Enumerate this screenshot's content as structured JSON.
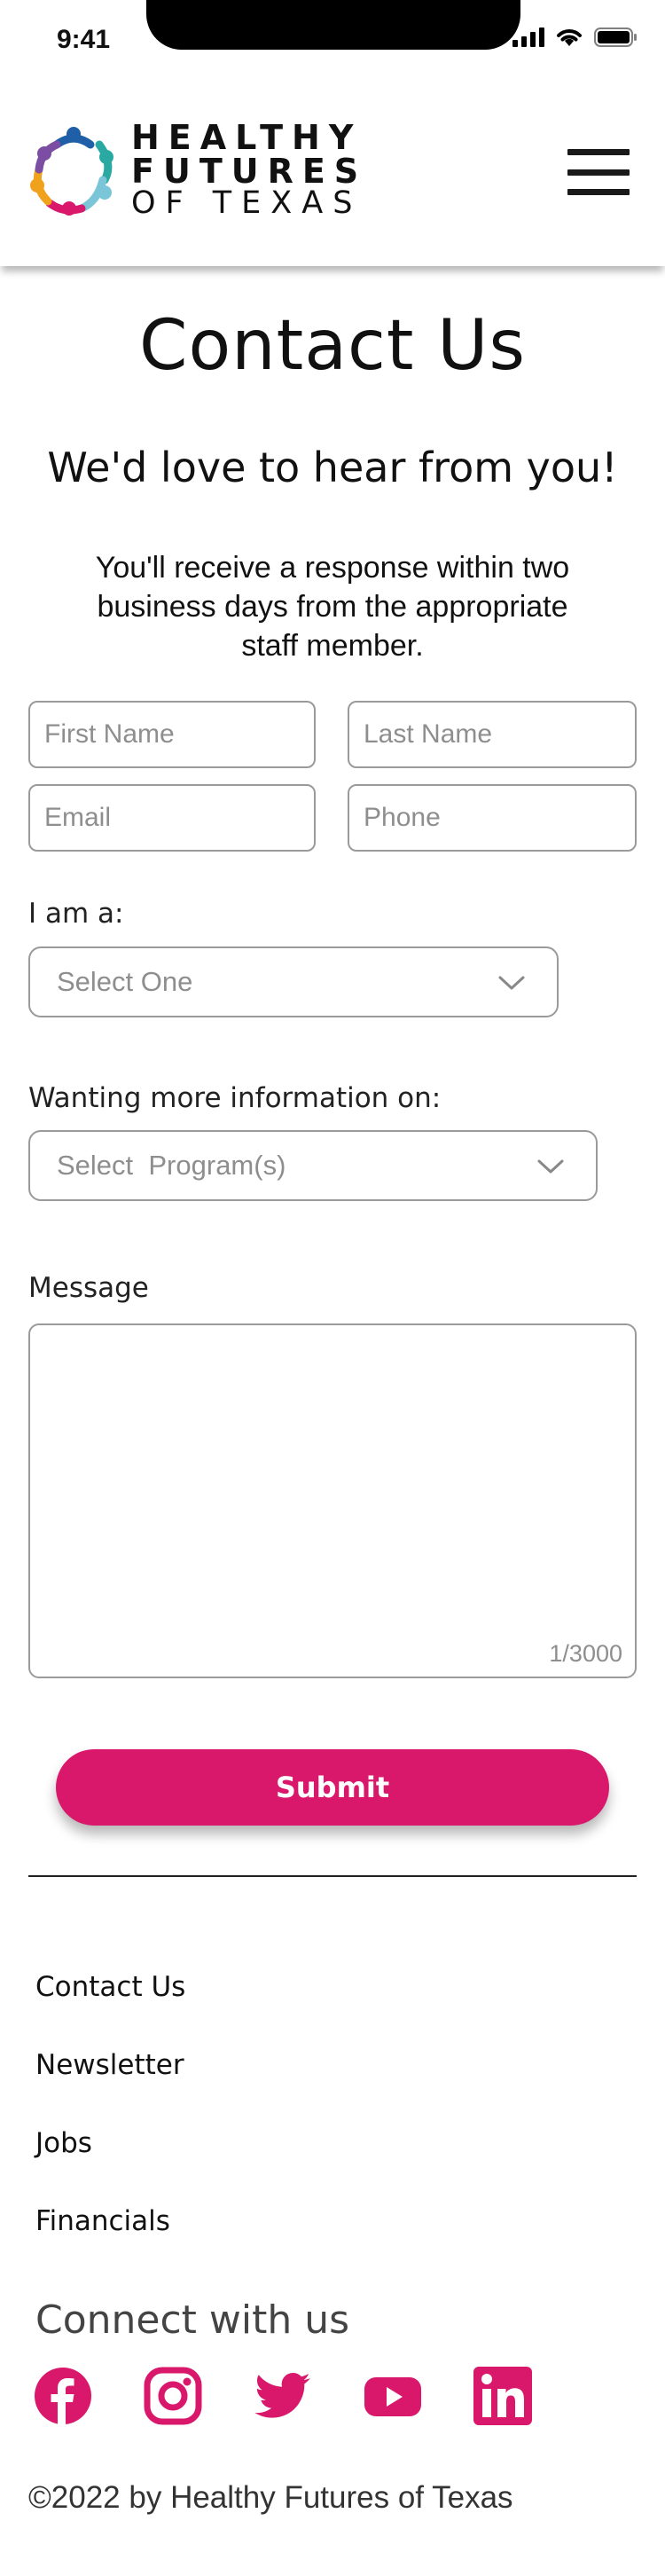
{
  "status_bar": {
    "time": "9:41"
  },
  "header": {
    "logo": {
      "line1": "HEALTHY",
      "line2": "FUTURES",
      "line3": "OF TEXAS"
    }
  },
  "main": {
    "title": "Contact Us",
    "subtitle": "We'd love to hear from you!",
    "intro": "You'll receive a response within two business days from the appropriate staff member."
  },
  "form": {
    "first_name": {
      "placeholder": "First Name",
      "value": ""
    },
    "last_name": {
      "placeholder": "Last Name",
      "value": ""
    },
    "email": {
      "placeholder": "Email",
      "value": ""
    },
    "phone": {
      "placeholder": "Phone",
      "value": ""
    },
    "role_label": "I am a:",
    "role_select": "Select One",
    "info_label": "Wanting more information on:",
    "info_select": "Select  Program(s)",
    "message_label": "Message",
    "message_counter": "1/3000",
    "submit_label": "Submit"
  },
  "footer": {
    "links": [
      "Contact Us",
      "Newsletter",
      "Jobs",
      "Financials"
    ],
    "connect_label": "Connect with us",
    "social_icons": [
      "facebook-icon",
      "instagram-icon",
      "twitter-icon",
      "youtube-icon",
      "linkedin-icon"
    ],
    "copyright": "©2022 by Healthy Futures of Texas"
  },
  "colors": {
    "accent": "#d9176b",
    "border": "#9a9a9a",
    "placeholder": "#8e8e8e"
  }
}
